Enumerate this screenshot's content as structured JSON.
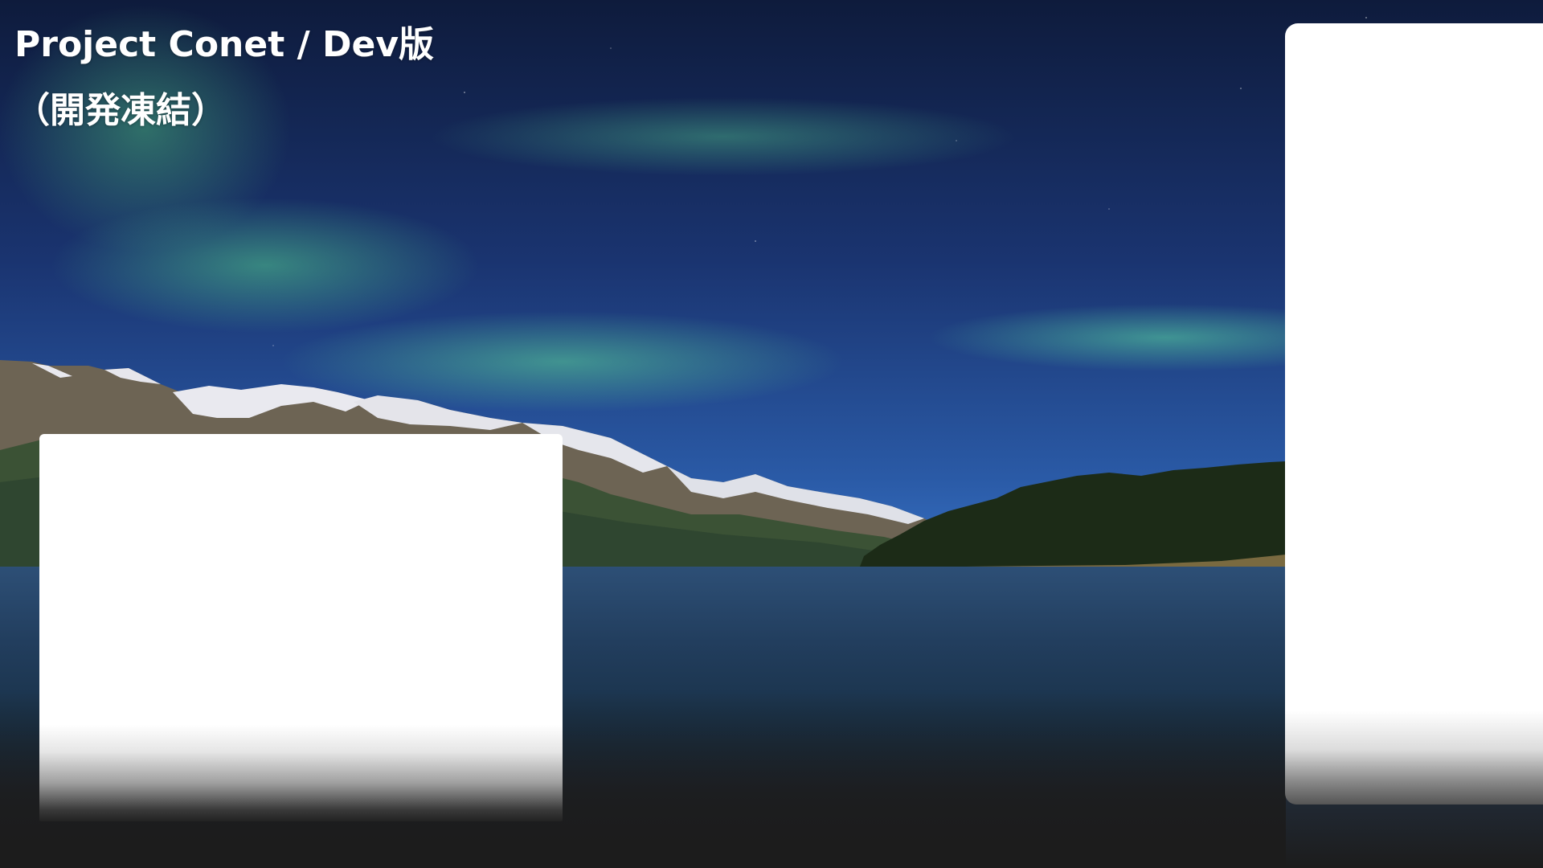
{
  "window": {
    "title": "Project Conet / Dev版",
    "subtitle": "（開発凍結）"
  },
  "wallpaper": {
    "description_icon": "aurora-lake-wallpaper"
  },
  "colors": {
    "background": "#1c1c1c",
    "panel": "#ffffff",
    "title_text": "#ffffff"
  }
}
